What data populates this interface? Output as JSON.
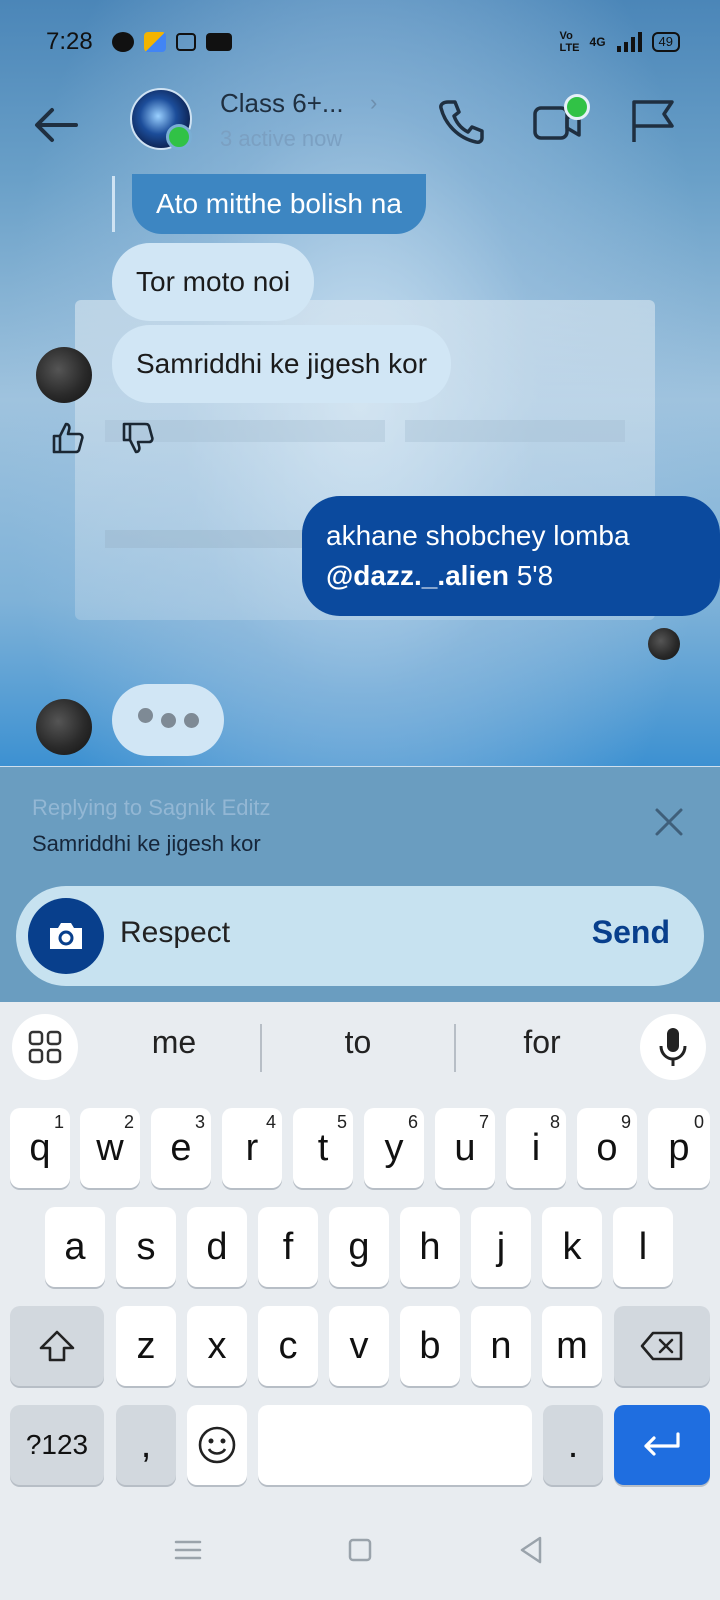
{
  "status_bar": {
    "time": "7:28",
    "battery": "49",
    "network": "4G"
  },
  "header": {
    "group_name": "Class 6+...",
    "chevron": "›",
    "subtitle": "3 active now",
    "icons": [
      "back-arrow-icon",
      "phone-icon",
      "video-icon",
      "flag-icon"
    ]
  },
  "messages": {
    "quoted": "Ato mitthe bolish na",
    "incoming": [
      "Tor moto noi",
      "Samriddhi ke jigesh kor"
    ],
    "outgoing_line1": "akhane shobchey lomba",
    "outgoing_mention": "@dazz._.alien",
    "outgoing_rest": " 5'8"
  },
  "reply": {
    "prefix": "Replying to ",
    "name": "Sagnik Editz",
    "text": "Samriddhi ke jigesh kor"
  },
  "composer": {
    "value": "Respect",
    "send_label": "Send"
  },
  "keyboard": {
    "suggestions": [
      "me",
      "to",
      "for"
    ],
    "row1": [
      "q",
      "w",
      "e",
      "r",
      "t",
      "y",
      "u",
      "i",
      "o",
      "p"
    ],
    "row1_nums": [
      "1",
      "2",
      "3",
      "4",
      "5",
      "6",
      "7",
      "8",
      "9",
      "0"
    ],
    "row2": [
      "a",
      "s",
      "d",
      "f",
      "g",
      "h",
      "j",
      "k",
      "l"
    ],
    "row3": [
      "z",
      "x",
      "c",
      "v",
      "b",
      "n",
      "m"
    ],
    "symbols_label": "?123",
    "comma": ",",
    "period": "."
  },
  "colors": {
    "outgoing_bubble": "#0b4a9e",
    "incoming_bubble": "#d1e6f5",
    "send": "#083f8c",
    "enter_key": "#1f6ee0",
    "online": "#31c246"
  }
}
